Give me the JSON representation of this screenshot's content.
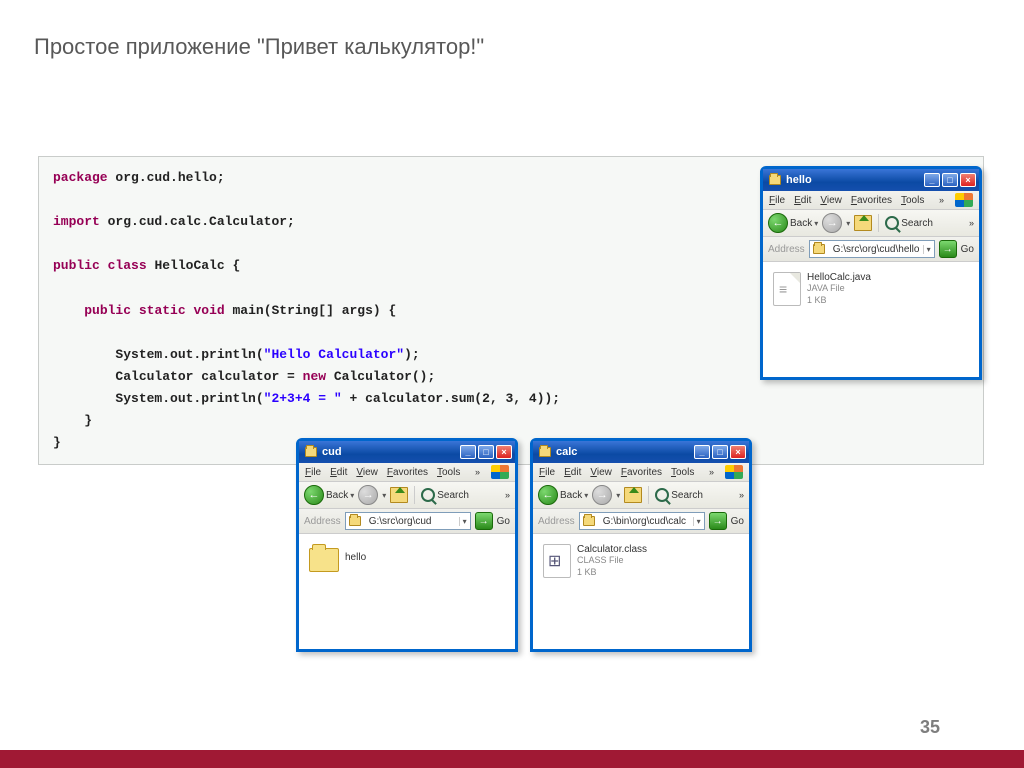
{
  "slide": {
    "title": "Простое приложение \"Привет калькулятор!\"",
    "page_number": "35"
  },
  "code": {
    "kw_package": "package",
    "pkg": " org.cud.hello;",
    "kw_import": "import",
    "imp": " org.cud.calc.Calculator;",
    "kw_public": "public",
    "kw_class": "class",
    "cls_name": "HelloCalc",
    "brace_open": " {",
    "kw_static": "static",
    "kw_void": "void",
    "main_sig": " main(String[] args) {",
    "sys1a": "System.out.println(",
    "str1": "\"Hello Calculator\"",
    "sys1b": ");",
    "ln2": "Calculator calculator = ",
    "kw_new": "new",
    "ln2b": " Calculator();",
    "sys3a": "System.out.println(",
    "str3": "\"2+3+4 = \"",
    "sys3b": " + calculator.sum(2, 3, 4));",
    "brace_c1": "    }",
    "brace_c2": "}"
  },
  "menus": {
    "file": "File",
    "edit": "Edit",
    "view": "View",
    "favorites": "Favorites",
    "tools": "Tools",
    "chev": "»"
  },
  "toolbar": {
    "back": "Back",
    "search": "Search",
    "go": "Go",
    "address_label": "Address"
  },
  "win_hello": {
    "title": "hello",
    "path": "G:\\src\\org\\cud\\hello",
    "file": {
      "name": "HelloCalc.java",
      "type": "JAVA File",
      "size": "1 KB"
    }
  },
  "win_cud": {
    "title": "cud",
    "path": "G:\\src\\org\\cud",
    "folder": {
      "name": "hello"
    }
  },
  "win_calc": {
    "title": "calc",
    "path": "G:\\bin\\org\\cud\\calc",
    "file": {
      "name": "Calculator.class",
      "type": "CLASS File",
      "size": "1 KB"
    }
  }
}
